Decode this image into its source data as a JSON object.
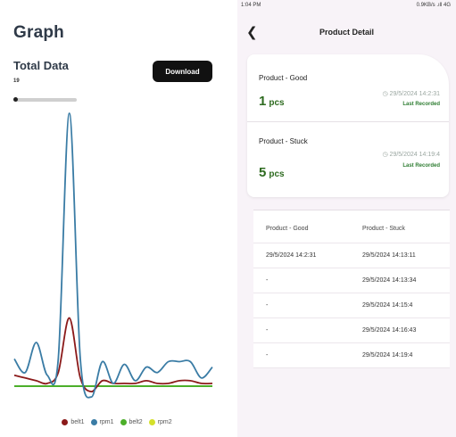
{
  "left": {
    "title": "Graph",
    "total_label": "Total Data",
    "total_value": "19",
    "download_label": "Download"
  },
  "chart_data": {
    "type": "line",
    "xlabel": "",
    "ylabel": "",
    "x": [
      0,
      1,
      2,
      3,
      4,
      5,
      6,
      7,
      8,
      9,
      10,
      11,
      12,
      13,
      14,
      15,
      16,
      17,
      18
    ],
    "series": [
      {
        "name": "belt1",
        "color": "#8b1a1a",
        "values": [
          4,
          3,
          2,
          1,
          5,
          25,
          3,
          -2,
          2,
          1,
          1,
          1,
          2,
          1,
          1,
          2,
          2,
          1,
          1
        ]
      },
      {
        "name": "rpm1",
        "color": "#3a7ca5",
        "values": [
          10,
          5,
          16,
          4,
          10,
          100,
          10,
          -4,
          9,
          1,
          8,
          2,
          7,
          5,
          9,
          9,
          9,
          3,
          7
        ]
      },
      {
        "name": "belt2",
        "color": "#4caf2a",
        "values": [
          0,
          0,
          0,
          0,
          0,
          0,
          0,
          0,
          0,
          0,
          0,
          0,
          0,
          0,
          0,
          0,
          0,
          0,
          0
        ]
      },
      {
        "name": "rpm2",
        "color": "#d4e02a",
        "values": [
          0,
          0,
          0,
          0,
          0,
          0,
          0,
          0,
          0,
          0,
          0,
          0,
          0,
          0,
          0,
          0,
          0,
          0,
          0
        ]
      }
    ],
    "legend_position": "bottom",
    "grid": false
  },
  "right": {
    "status_time": "1:04 PM",
    "status_right": "0.9KB/s  .ıll 4G",
    "header_title": "Product Detail",
    "good": {
      "label": "Product - Good",
      "value": "1",
      "unit": "pcs",
      "date": "29/5/2024 14:2:31",
      "status": "Last Recorded"
    },
    "stuck": {
      "label": "Product - Stuck",
      "value": "5",
      "unit": "pcs",
      "date": "29/5/2024 14:19:4",
      "status": "Last Recorded"
    },
    "table": {
      "headers": [
        "Product - Good",
        "Product - Stuck"
      ],
      "rows": [
        [
          "29/5/2024 14:2:31",
          "29/5/2024 14:13:11"
        ],
        [
          "-",
          "29/5/2024 14:13:34"
        ],
        [
          "-",
          "29/5/2024 14:15:4"
        ],
        [
          "-",
          "29/5/2024 14:16:43"
        ],
        [
          "-",
          "29/5/2024 14:19:4"
        ]
      ]
    }
  }
}
